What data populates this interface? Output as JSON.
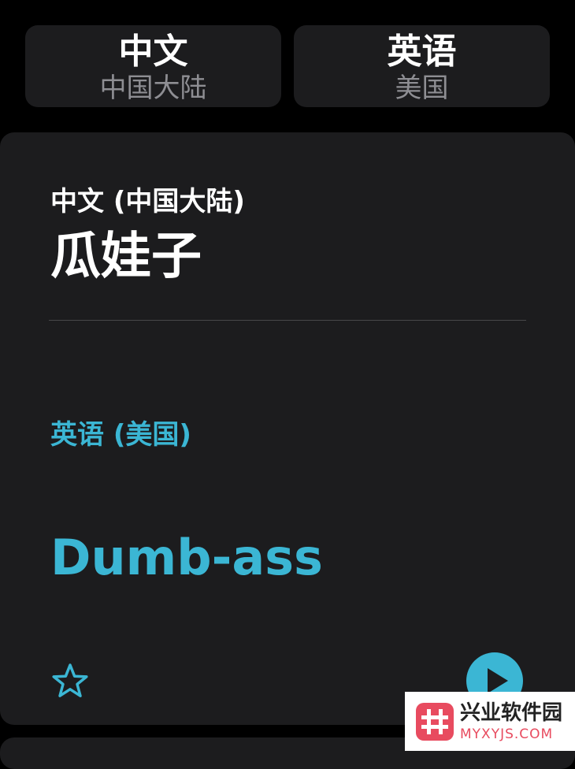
{
  "language_picker": {
    "source": {
      "name": "中文",
      "region": "中国大陆"
    },
    "target": {
      "name": "英语",
      "region": "美国"
    }
  },
  "translation_card": {
    "source_language": "中文 (中国大陆)",
    "source_text": "瓜娃子",
    "target_language": "英语 (美国)",
    "target_text": "Dumb-ass",
    "favorite_icon": "star-outline-icon",
    "play_icon": "play-circle-icon"
  },
  "colors": {
    "background": "#000000",
    "card": "#1c1c1e",
    "accent": "#3bb6d4",
    "secondary_text": "#8e8e93"
  },
  "watermark": {
    "title": "兴业软件园",
    "subtitle": "MYXYJS.COM"
  }
}
